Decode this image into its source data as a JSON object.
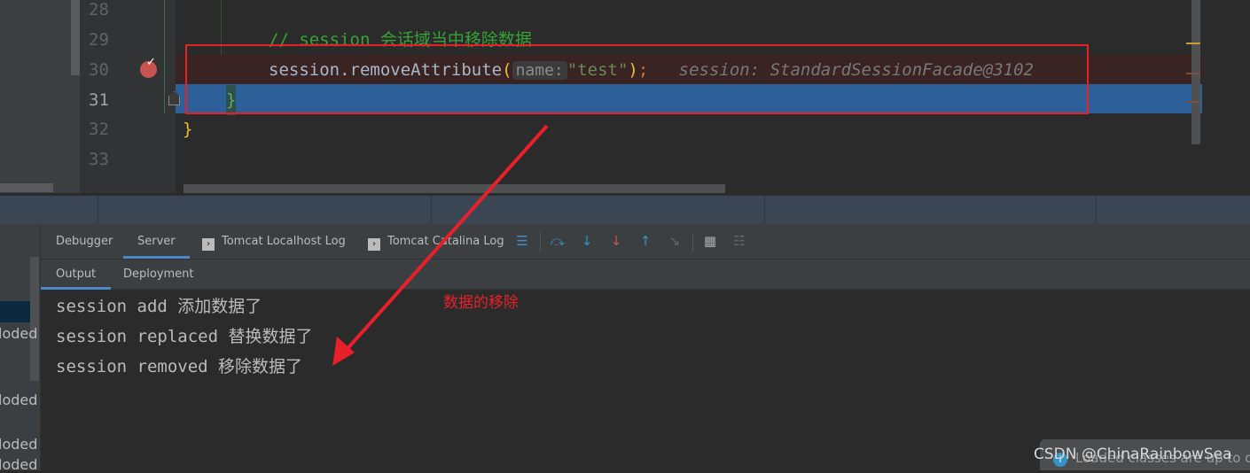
{
  "editor": {
    "line_numbers": [
      "28",
      "29",
      "30",
      "31",
      "32",
      "33"
    ],
    "current_line": "31",
    "comment": "// session 会话域当中移除数据",
    "call_prefix": "session.removeAttribute",
    "param_hint": "name:",
    "arg": "\"test\"",
    "close_paren": ")",
    "semicolon": ";",
    "inline_value": "session: StandardSessionFacade@3102",
    "brace_inner": "}",
    "brace_outer": "}"
  },
  "debug_tabs": [
    {
      "label": "Debugger"
    },
    {
      "label": "Server",
      "active": true
    },
    {
      "label": "Tomcat Localhost Log"
    },
    {
      "label": "Tomcat Catalina Log"
    }
  ],
  "toolbar_icons": [
    "menu-icon",
    "step-over-icon",
    "step-into-icon",
    "force-step-into-icon",
    "step-out-icon",
    "run-to-cursor-icon",
    "evaluate-icon",
    "trace-icon"
  ],
  "sub_tabs": [
    {
      "label": "Output",
      "active": true
    },
    {
      "label": "Deployment"
    }
  ],
  "console_lines": [
    "session add 添加数据了",
    "session replaced 替换数据了",
    "session removed 移除数据了"
  ],
  "left_panel_items": [
    "loded",
    "loded",
    "loded",
    "loded"
  ],
  "annotation": "数据的移除",
  "notification": "Loaded classes are up to da",
  "watermark": "CSDN @ChinaRainbowSea",
  "colors": {
    "highlight_line": "#2d5f99",
    "breakpoint_line": "#3a2323",
    "annotation_red": "#e8202a",
    "accent": "#4a88c7"
  }
}
